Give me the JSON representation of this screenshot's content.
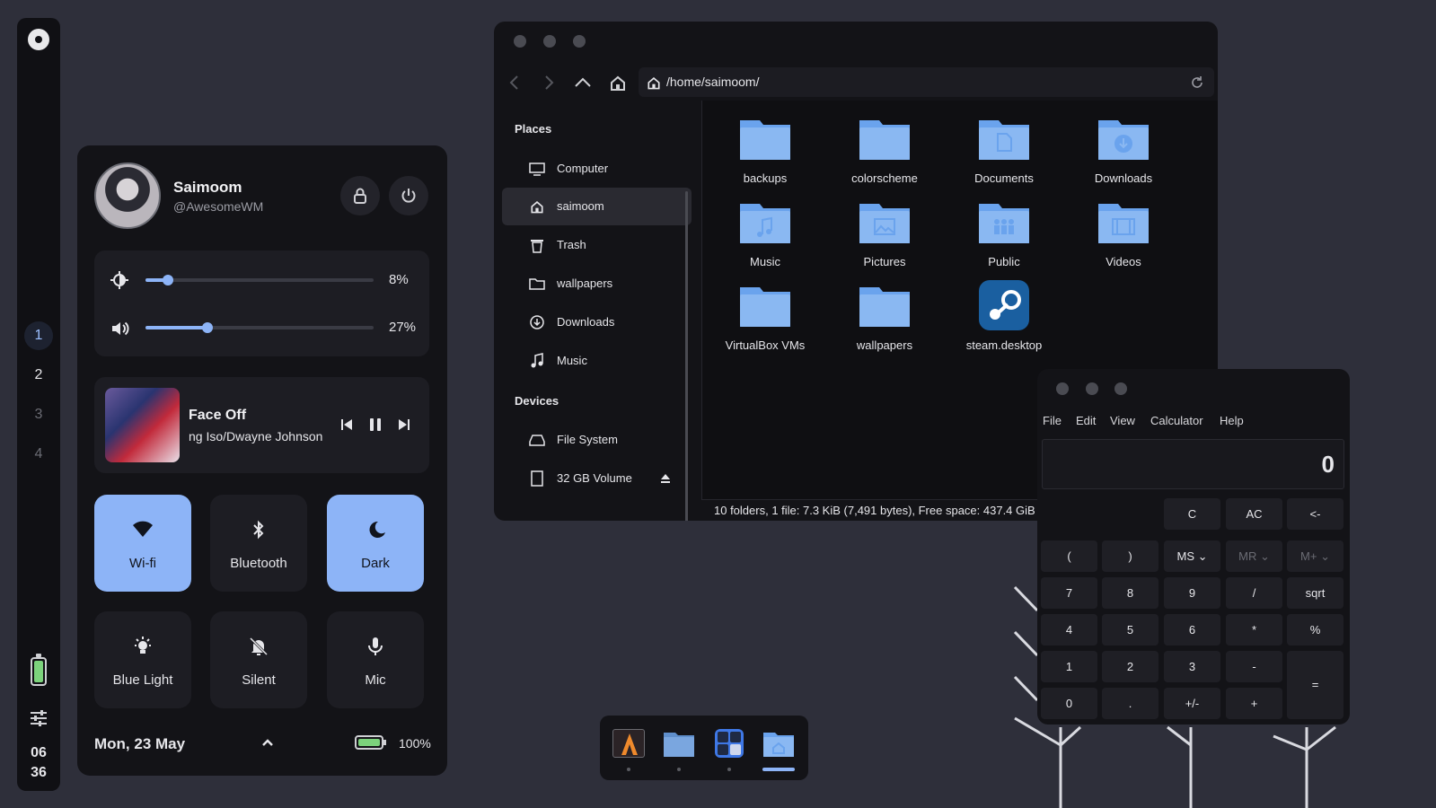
{
  "bar": {
    "workspaces": [
      "1",
      "2",
      "3",
      "4"
    ],
    "clock_hour": "06",
    "clock_min": "36"
  },
  "cc": {
    "user_name": "Saimoom",
    "user_handle": "@AwesomeWM",
    "brightness": {
      "value_label": "8%",
      "fraction": 0.08
    },
    "volume": {
      "value_label": "27%",
      "fraction": 0.27
    },
    "media": {
      "title": "Face Off",
      "artist": "ng Iso/Dwayne Johnson"
    },
    "tiles": [
      {
        "label": "Wi-fi",
        "on": true
      },
      {
        "label": "Bluetooth",
        "on": false
      },
      {
        "label": "Dark",
        "on": true
      },
      {
        "label": "Blue Light",
        "on": false
      },
      {
        "label": "Silent",
        "on": false
      },
      {
        "label": "Mic",
        "on": false
      }
    ],
    "date": "Mon, 23 May",
    "battery_label": "100%",
    "battery_fraction": 1.0
  },
  "fm": {
    "path": "/home/saimoom/",
    "places_header": "Places",
    "devices_header": "Devices",
    "places": [
      "Computer",
      "saimoom",
      "Trash",
      "wallpapers",
      "Downloads",
      "Music"
    ],
    "devices": [
      "File System",
      "32 GB Volume"
    ],
    "files": [
      "backups",
      "colorscheme",
      "Documents",
      "Downloads",
      "Music",
      "Pictures",
      "Public",
      "Videos",
      "VirtualBox VMs",
      "wallpapers",
      "steam.desktop"
    ],
    "status": "10 folders, 1 file: 7.3 KiB (7,491 bytes), Free space: 437.4 GiB"
  },
  "calc": {
    "menu": [
      "File",
      "Edit",
      "View",
      "Calculator",
      "Help"
    ],
    "display": "0",
    "keys": {
      "r0": [
        "C",
        "AC",
        "<-"
      ],
      "r1": [
        "(",
        ")",
        "MS",
        "MR",
        "M+"
      ],
      "r2": [
        "7",
        "8",
        "9",
        "/",
        "sqrt"
      ],
      "r3": [
        "4",
        "5",
        "6",
        "*",
        "%"
      ],
      "r4": [
        "1",
        "2",
        "3",
        "-"
      ],
      "r5": [
        "0",
        ".",
        "+/-",
        "+"
      ],
      "eq": "="
    }
  },
  "colors": {
    "accent": "#8db4f7",
    "bg": "#2e2f3a",
    "panel": "#131317"
  }
}
